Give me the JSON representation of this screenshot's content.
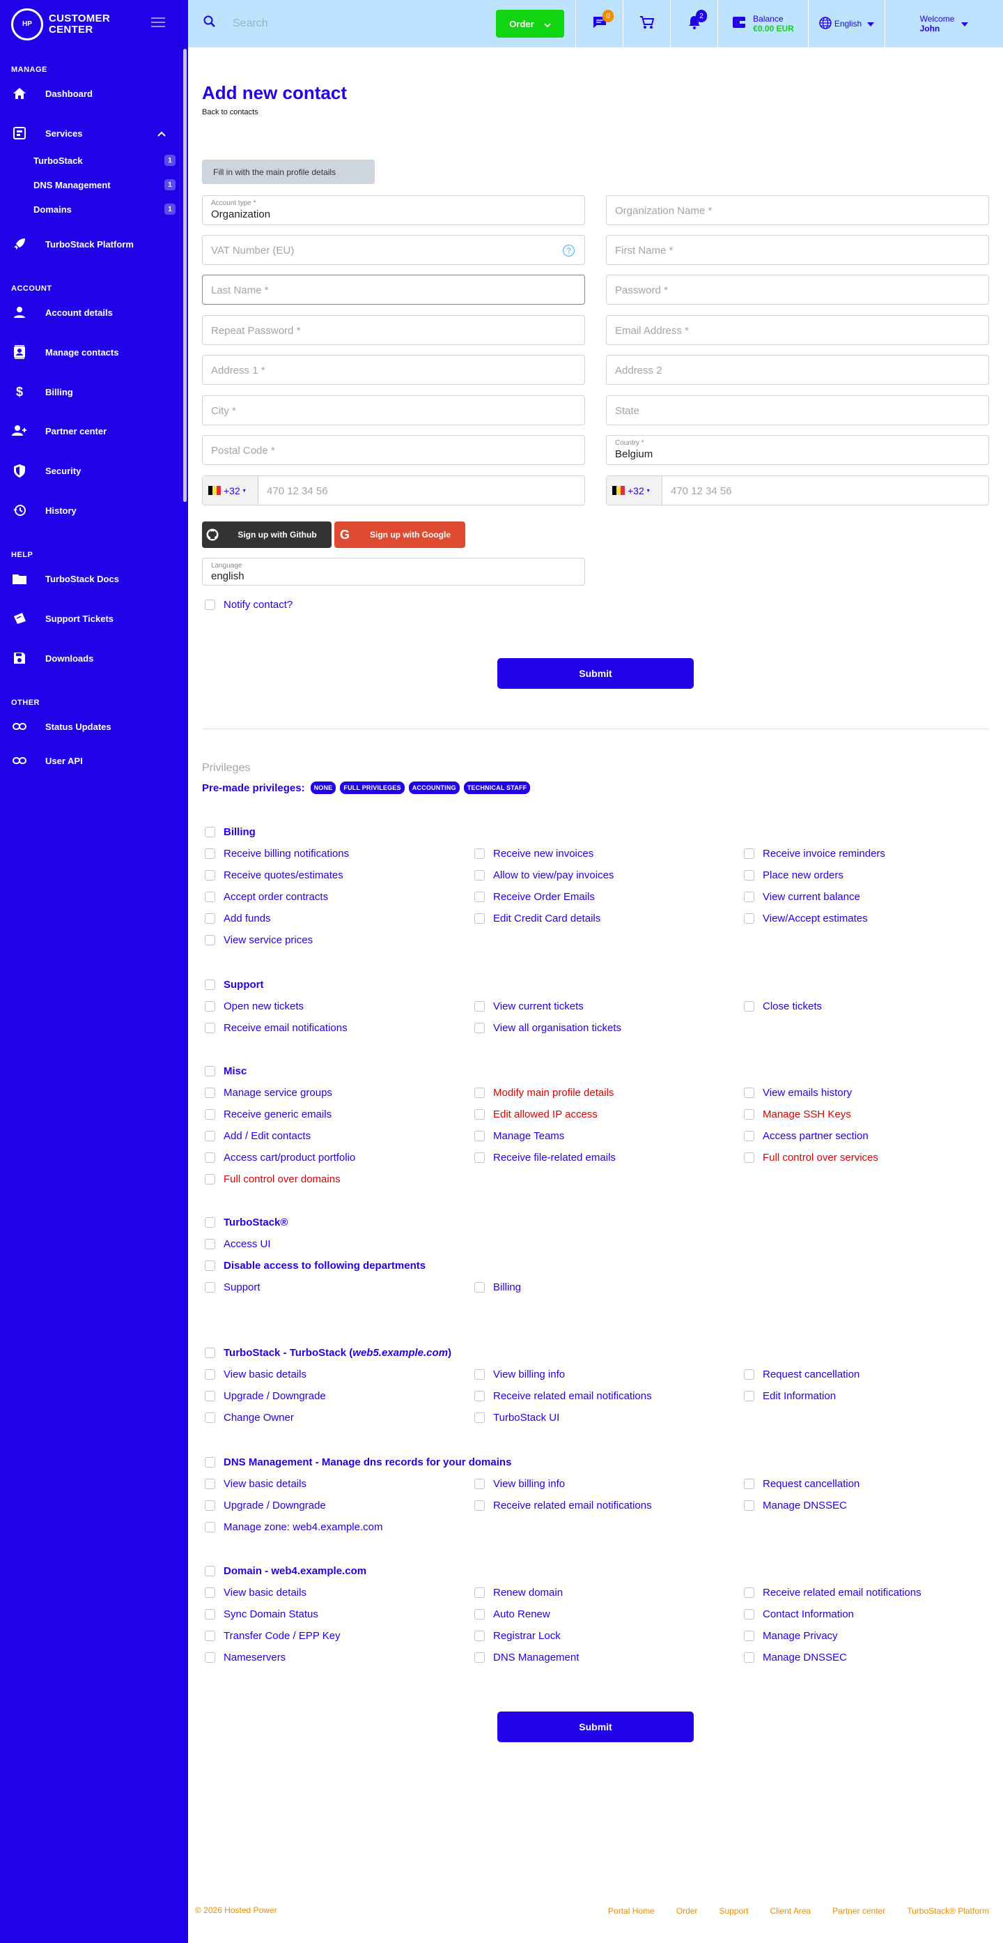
{
  "brand": {
    "logo_text": "HOSTED POWER",
    "name_line1": "CUSTOMER",
    "name_line2": "CENTER"
  },
  "sidebar": {
    "sections": {
      "manage": "MANAGE",
      "account": "ACCOUNT",
      "help": "HELP",
      "other": "OTHER"
    },
    "items": {
      "dashboard": "Dashboard",
      "services": "Services",
      "turbostack_platform": "TurboStack Platform",
      "account_details": "Account details",
      "manage_contacts": "Manage contacts",
      "billing": "Billing",
      "partner_center": "Partner center",
      "security": "Security",
      "history": "History",
      "turbostack_docs": "TurboStack Docs",
      "support_tickets": "Support Tickets",
      "downloads": "Downloads",
      "status_updates": "Status Updates",
      "user_api": "User API"
    },
    "services_sub": [
      {
        "label": "TurboStack",
        "count": "1"
      },
      {
        "label": "DNS Management",
        "count": "1"
      },
      {
        "label": "Domains",
        "count": "1"
      }
    ]
  },
  "topbar": {
    "search_placeholder": "Search",
    "order_label": "Order",
    "messages_count": "0",
    "notifications_count": "2",
    "balance_label": "Balance",
    "balance_amount": "€0.00 EUR",
    "language": "English",
    "welcome": "Welcome",
    "user": "John"
  },
  "page": {
    "title": "Add new contact",
    "back": "Back to contacts",
    "info": "Fill in with the main profile details",
    "account_type_label": "Account type *",
    "account_type_value": "Organization",
    "org_name": "Organization Name *",
    "vat": "VAT Number (EU)",
    "help": "?",
    "first_name": "First Name *",
    "last_name": "Last Name *",
    "password": "Password *",
    "repeat_password": "Repeat Password *",
    "email": "Email Address *",
    "address1": "Address 1 *",
    "address2": "Address 2",
    "city": "City *",
    "state": "State",
    "postal": "Postal Code *",
    "country_label": "Country *",
    "country_value": "Belgium",
    "phone_code": "+32",
    "phone_placeholder": "470 12 34 56",
    "github": "Sign up with Github",
    "google": "Sign up with Google",
    "language_label": "Language",
    "language_value": "english",
    "notify": "Notify contact?",
    "submit": "Submit"
  },
  "privileges": {
    "heading": "Privileges",
    "premade_label": "Pre-made privileges:",
    "pills": [
      "NONE",
      "FULL PRIVILEGES",
      "ACCOUNTING",
      "TECHNICAL STAFF"
    ],
    "groups": {
      "billing": {
        "title": "Billing",
        "options": [
          "Receive billing notifications",
          "Receive new invoices",
          "Receive invoice reminders",
          "Receive quotes/estimates",
          "Allow to view/pay invoices",
          "Place new orders",
          "Accept order contracts",
          "Receive Order Emails",
          "View current balance",
          "Add funds",
          "Edit Credit Card details",
          "View/Accept estimates",
          "View service prices"
        ]
      },
      "support": {
        "title": "Support",
        "options": [
          "Open new tickets",
          "View current tickets",
          "Close tickets",
          "Receive email notifications",
          "View all organisation tickets"
        ]
      },
      "misc": {
        "title": "Misc",
        "options": [
          "Manage service groups",
          "Modify main profile details",
          "View emails history",
          "Receive generic emails",
          "Edit allowed IP access",
          "Manage SSH Keys",
          "Add / Edit contacts",
          "Manage Teams",
          "Access partner section",
          "Access cart/product portfolio",
          "Receive file-related emails",
          "Full control over services",
          "Full control over domains"
        ]
      },
      "turbostack": {
        "title": "TurboStack®",
        "options": [
          "Access UI"
        ]
      },
      "departments": {
        "title": "Disable access to following departments",
        "options": [
          "Support",
          "Billing"
        ]
      },
      "ts_service": {
        "title": "TurboStack - TurboStack (",
        "title_host": " web5.example.com ",
        "title_end": ")",
        "options": [
          "View basic details",
          "View billing info",
          "Request cancellation",
          "Upgrade / Downgrade",
          "Receive related email notifications",
          "Edit Information",
          "Change Owner",
          "TurboStack UI"
        ]
      },
      "dns": {
        "title": "DNS Management - Manage dns records for your domains",
        "options": [
          "View basic details",
          "View billing info",
          "Request cancellation",
          "Upgrade / Downgrade",
          "Receive related email notifications",
          "Manage DNSSEC",
          "Manage zone: web4.example.com"
        ]
      },
      "domain": {
        "title": "Domain - web4.example.com",
        "options": [
          "View basic details",
          "Renew domain",
          "Receive related email notifications",
          "Sync Domain Status",
          "Auto Renew",
          "Contact Information",
          "Transfer Code / EPP Key",
          "Registrar Lock",
          "Manage Privacy",
          "Nameservers",
          "DNS Management",
          "Manage DNSSEC"
        ]
      }
    }
  },
  "footer": {
    "copyright": "© 2026 Hosted Power",
    "links": [
      "Portal Home",
      "Order",
      "Support",
      "Client Area",
      "Partner center",
      "TurboStack® Platform"
    ]
  },
  "colors": {
    "primary": "#2200e8",
    "topbar": "#bde3ff",
    "accent_green": "#10d510",
    "danger": "#e00000",
    "footer": "#f08c00"
  }
}
